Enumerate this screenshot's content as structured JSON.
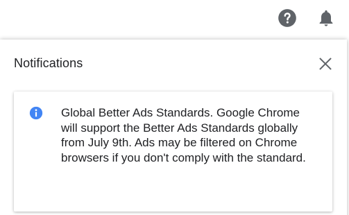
{
  "header": {
    "help_icon": "help-circle-icon",
    "notifications_icon": "bell-icon"
  },
  "panel": {
    "title": "Notifications",
    "close_icon": "close-icon"
  },
  "notification": {
    "icon": "info-icon",
    "icon_color": "#4285f4",
    "text": "Global Better Ads Standards. Google Chrome will support the Better Ads Standards globally from July 9th. Ads may be filtered on Chrome browsers if you don't comply with the standard."
  },
  "colors": {
    "icon_gray": "#5f6368",
    "text": "#202124",
    "accent_blue": "#4285f4"
  }
}
